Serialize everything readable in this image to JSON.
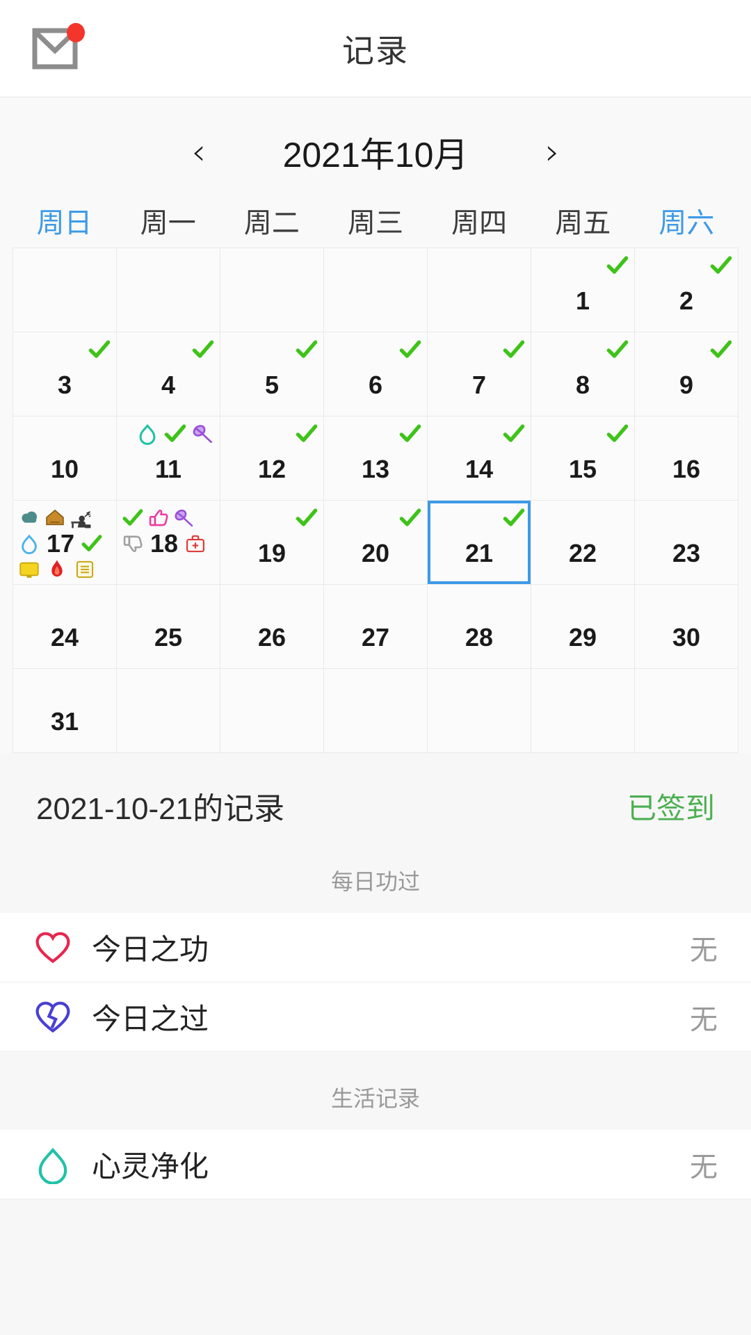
{
  "header": {
    "title": "记录",
    "mail_icon": "envelope-icon",
    "badge": true
  },
  "calendar": {
    "prev_label": "‹",
    "next_label": "›",
    "month_label": "2021年10月",
    "weekdays": [
      {
        "label": "周日",
        "weekend": true
      },
      {
        "label": "周一",
        "weekend": false
      },
      {
        "label": "周二",
        "weekend": false
      },
      {
        "label": "周三",
        "weekend": false
      },
      {
        "label": "周四",
        "weekend": false
      },
      {
        "label": "周五",
        "weekend": false
      },
      {
        "label": "周六",
        "weekend": true
      }
    ],
    "selected_day": 21,
    "weeks": [
      [
        {
          "day": ""
        },
        {
          "day": ""
        },
        {
          "day": ""
        },
        {
          "day": ""
        },
        {
          "day": ""
        },
        {
          "day": "1",
          "icons_top": [
            "check-icon"
          ]
        },
        {
          "day": "2",
          "icons_top": [
            "check-icon"
          ]
        }
      ],
      [
        {
          "day": "3",
          "icons_top": [
            "check-icon"
          ]
        },
        {
          "day": "4",
          "icons_top": [
            "check-icon"
          ]
        },
        {
          "day": "5",
          "icons_top": [
            "check-icon"
          ]
        },
        {
          "day": "6",
          "icons_top": [
            "check-icon"
          ]
        },
        {
          "day": "7",
          "icons_top": [
            "check-icon"
          ]
        },
        {
          "day": "8",
          "icons_top": [
            "check-icon"
          ]
        },
        {
          "day": "9",
          "icons_top": [
            "check-icon"
          ]
        }
      ],
      [
        {
          "day": "10"
        },
        {
          "day": "11",
          "icons_top": [
            "water-drop-icon",
            "check-icon",
            "badminton-racket-icon"
          ]
        },
        {
          "day": "12",
          "icons_top": [
            "check-icon"
          ]
        },
        {
          "day": "13",
          "icons_top": [
            "check-icon"
          ]
        },
        {
          "day": "14",
          "icons_top": [
            "check-icon"
          ]
        },
        {
          "day": "15",
          "icons_top": [
            "check-icon"
          ]
        },
        {
          "day": "16"
        }
      ],
      [
        {
          "day": "17",
          "dense": true,
          "icons_top": [
            "cloud-icon",
            "house-icon",
            "study-desk-icon"
          ],
          "icons_mid": [
            "water-drop-blue-icon",
            "check-icon"
          ],
          "icons_bot": [
            "monitor-icon",
            "flame-icon",
            "note-list-icon"
          ]
        },
        {
          "day": "18",
          "dense": true,
          "icons_top": [
            "check-icon",
            "thumbs-up-icon",
            "badminton-racket-icon"
          ],
          "icons_mid": [
            "thumbs-down-icon",
            "first-aid-kit-icon"
          ]
        },
        {
          "day": "19",
          "icons_top": [
            "check-icon"
          ]
        },
        {
          "day": "20",
          "icons_top": [
            "check-icon"
          ]
        },
        {
          "day": "21",
          "icons_top": [
            "check-icon"
          ],
          "selected": true
        },
        {
          "day": "22"
        },
        {
          "day": "23"
        }
      ],
      [
        {
          "day": "24"
        },
        {
          "day": "25"
        },
        {
          "day": "26"
        },
        {
          "day": "27"
        },
        {
          "day": "28"
        },
        {
          "day": "29"
        },
        {
          "day": "30"
        }
      ],
      [
        {
          "day": "31"
        },
        {
          "day": ""
        },
        {
          "day": ""
        },
        {
          "day": ""
        },
        {
          "day": ""
        },
        {
          "day": ""
        },
        {
          "day": ""
        }
      ]
    ]
  },
  "record": {
    "date_title": "2021-10-21的记录",
    "status_label": "已签到",
    "sections": [
      {
        "title": "每日功过",
        "rows": [
          {
            "icon": "heart-outline-icon",
            "label": "今日之功",
            "value": "无"
          },
          {
            "icon": "broken-heart-icon",
            "label": "今日之过",
            "value": "无"
          }
        ]
      },
      {
        "title": "生活记录",
        "rows": [
          {
            "icon": "water-drop-outline-icon",
            "label": "心灵净化",
            "value": "无"
          }
        ]
      }
    ]
  },
  "colors": {
    "accent_blue": "#3d9ae8",
    "check_green": "#3ec318",
    "status_green": "#4caf50",
    "badge_red": "#f4352b",
    "heart_red": "#e8264e",
    "broken_heart_purple": "#4a3fd4",
    "drop_teal": "#1fc2a7"
  }
}
